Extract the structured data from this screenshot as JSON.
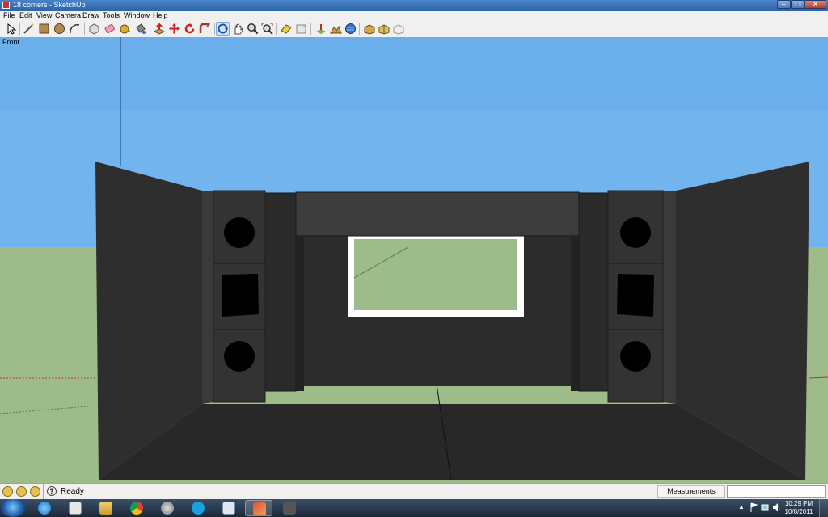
{
  "window": {
    "title": "18 corners - SketchUp"
  },
  "menu": [
    "File",
    "Edit",
    "View",
    "Camera",
    "Draw",
    "Tools",
    "Window",
    "Help"
  ],
  "toolbar": {
    "tools": [
      "select",
      "line",
      "rectangle",
      "circle",
      "arc",
      "make-component",
      "eraser",
      "tape-measure",
      "paint-bucket",
      "push-pull",
      "move",
      "rotate",
      "follow-me",
      "orbit",
      "pan",
      "zoom",
      "zoom-extents",
      "texture",
      "section-plane",
      "add-location",
      "toggle-terrain",
      "get-models",
      "share-model",
      "3d-warehouse",
      "share-component"
    ],
    "selected": "orbit"
  },
  "viewport": {
    "scene_label": "Front",
    "colors": {
      "sky": "#72b4ee",
      "ground": "#9ebb8a",
      "model": "#2c2c2c"
    }
  },
  "status": {
    "text": "Ready",
    "measurements_label": "Measurements",
    "measurements_value": ""
  },
  "taskbar": {
    "apps": [
      "internet-explorer",
      "media-player",
      "explorer",
      "chrome",
      "network",
      "skype",
      "paint",
      "sketchup",
      "camera"
    ],
    "time": "10:29 PM",
    "date": "10/8/2011"
  }
}
